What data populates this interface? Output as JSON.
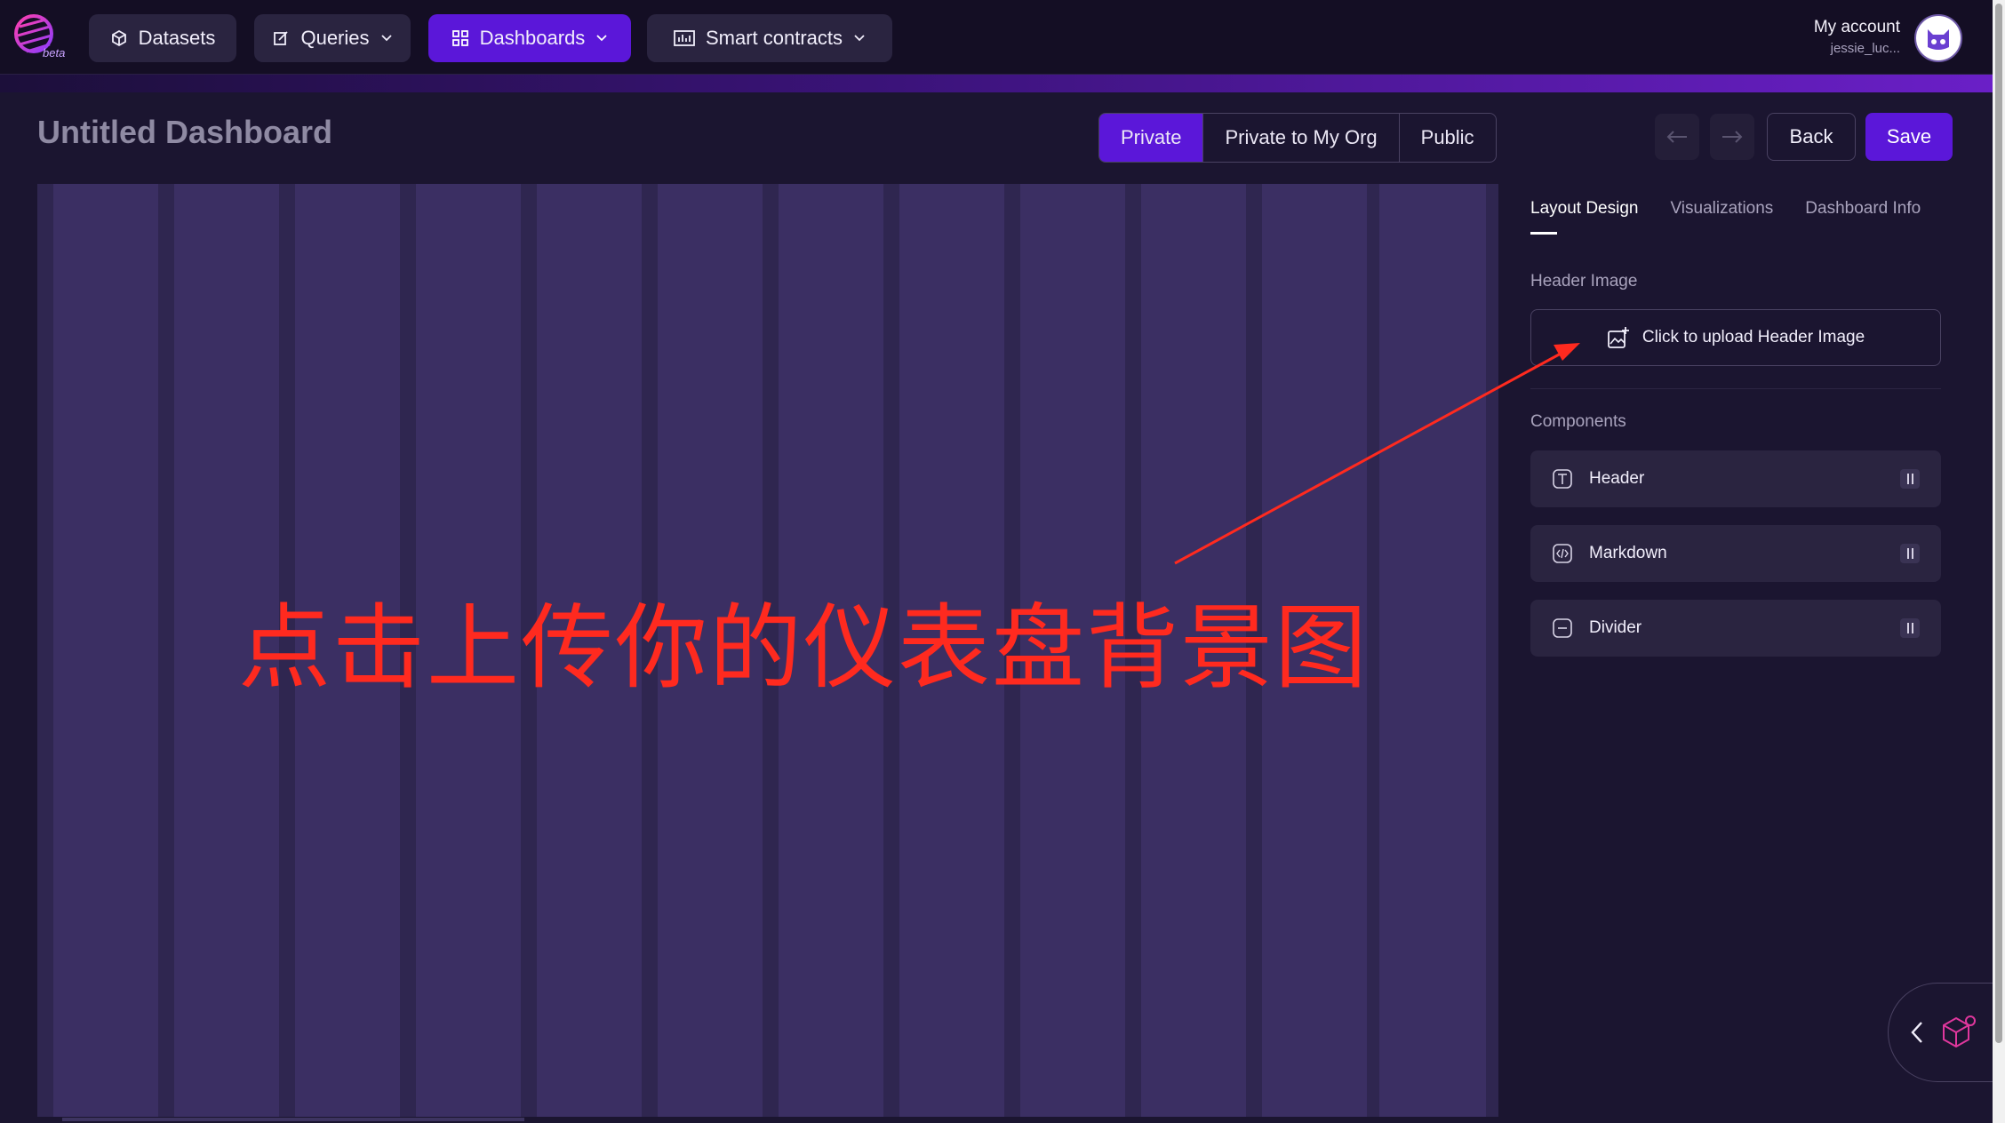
{
  "nav": {
    "logo_badge": "beta",
    "items": [
      {
        "label": "Datasets",
        "icon": "cube-icon"
      },
      {
        "label": "Queries",
        "icon": "edit-icon"
      },
      {
        "label": "Dashboards",
        "icon": "grid-icon"
      },
      {
        "label": "Smart contracts",
        "icon": "bar-chart-icon"
      }
    ],
    "account_label": "My account",
    "account_user": "jessie_luc..."
  },
  "dashboard": {
    "title": "Untitled Dashboard",
    "visibility_options": [
      "Private",
      "Private to My Org",
      "Public"
    ],
    "visibility_selected": "Private",
    "back_label": "Back",
    "save_label": "Save"
  },
  "sidebar": {
    "tabs": [
      "Layout Design",
      "Visualizations",
      "Dashboard Info"
    ],
    "active_tab": "Layout Design",
    "header_image_label": "Header Image",
    "upload_label": "Click to upload Header Image",
    "components_label": "Components",
    "components": [
      {
        "label": "Header",
        "icon": "text-icon"
      },
      {
        "label": "Markdown",
        "icon": "code-icon"
      },
      {
        "label": "Divider",
        "icon": "minus-icon"
      }
    ]
  },
  "annotation": {
    "text": "点击上传你的仪表盘背景图",
    "color": "#ff2a1f"
  },
  "colors": {
    "accent": "#5b17d9",
    "background": "#150f26",
    "panel": "#1b1530"
  }
}
